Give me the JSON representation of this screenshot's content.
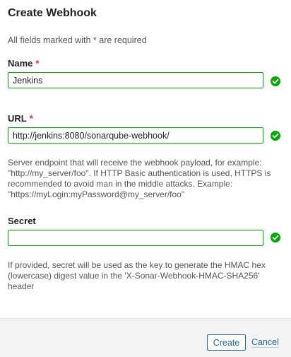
{
  "dialog": {
    "title": "Create Webhook",
    "required_note_prefix": "All fields marked with",
    "required_star": "*",
    "required_note_suffix": "are required"
  },
  "fields": {
    "name": {
      "label": "Name",
      "required_star": "*",
      "value": "Jenkins"
    },
    "url": {
      "label": "URL",
      "required_star": "*",
      "value": "http://jenkins:8080/sonarqube-webhook/",
      "help": "Server endpoint that will receive the webhook payload, for example: \"http://my_server/foo\". If HTTP Basic authentication is used, HTTPS is recommended to avoid man in the middle attacks. Example: \"https://myLogin:myPassword@my_server/foo\""
    },
    "secret": {
      "label": "Secret",
      "value": "",
      "help": "If provided, secret will be used as the key to generate the HMAC hex (lowercase) digest value in the 'X-Sonar-Webhook-HMAC-SHA256' header"
    }
  },
  "footer": {
    "create_label": "Create",
    "cancel_label": "Cancel"
  },
  "colors": {
    "valid_border": "#00aa00",
    "valid_icon": "#00aa00",
    "required_star": "#d4333f",
    "primary_link": "#236a97"
  },
  "icons": {
    "valid": "check-circle-icon"
  }
}
